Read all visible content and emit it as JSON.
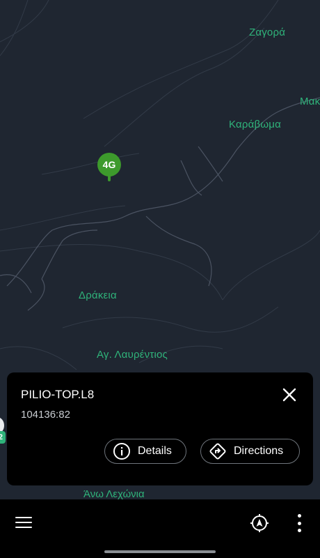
{
  "map": {
    "places": [
      {
        "name": "Ζαγορά"
      },
      {
        "name": "Μακ"
      },
      {
        "name": "Καράβωμα"
      },
      {
        "name": "Δράκεια"
      },
      {
        "name": "Αγ. Λαυρέντιος"
      }
    ],
    "marker_label": "4G",
    "side_marker_count": "2",
    "below_card_place": "Άνω Λεχώνια",
    "colors": {
      "background": "#1f2631",
      "place_text": "#2fb37a",
      "marker": "#3d9a2c"
    }
  },
  "card": {
    "title": "PILIO-TOP.L8",
    "subtitle": "104136:82",
    "details_label": "Details",
    "directions_label": "Directions",
    "icons": {
      "close": "close-icon",
      "details": "info-icon",
      "directions": "directions-icon"
    }
  },
  "bottom_bar": {
    "icons": [
      "menu-icon",
      "navigation-locate-icon",
      "more-vertical-icon"
    ]
  }
}
